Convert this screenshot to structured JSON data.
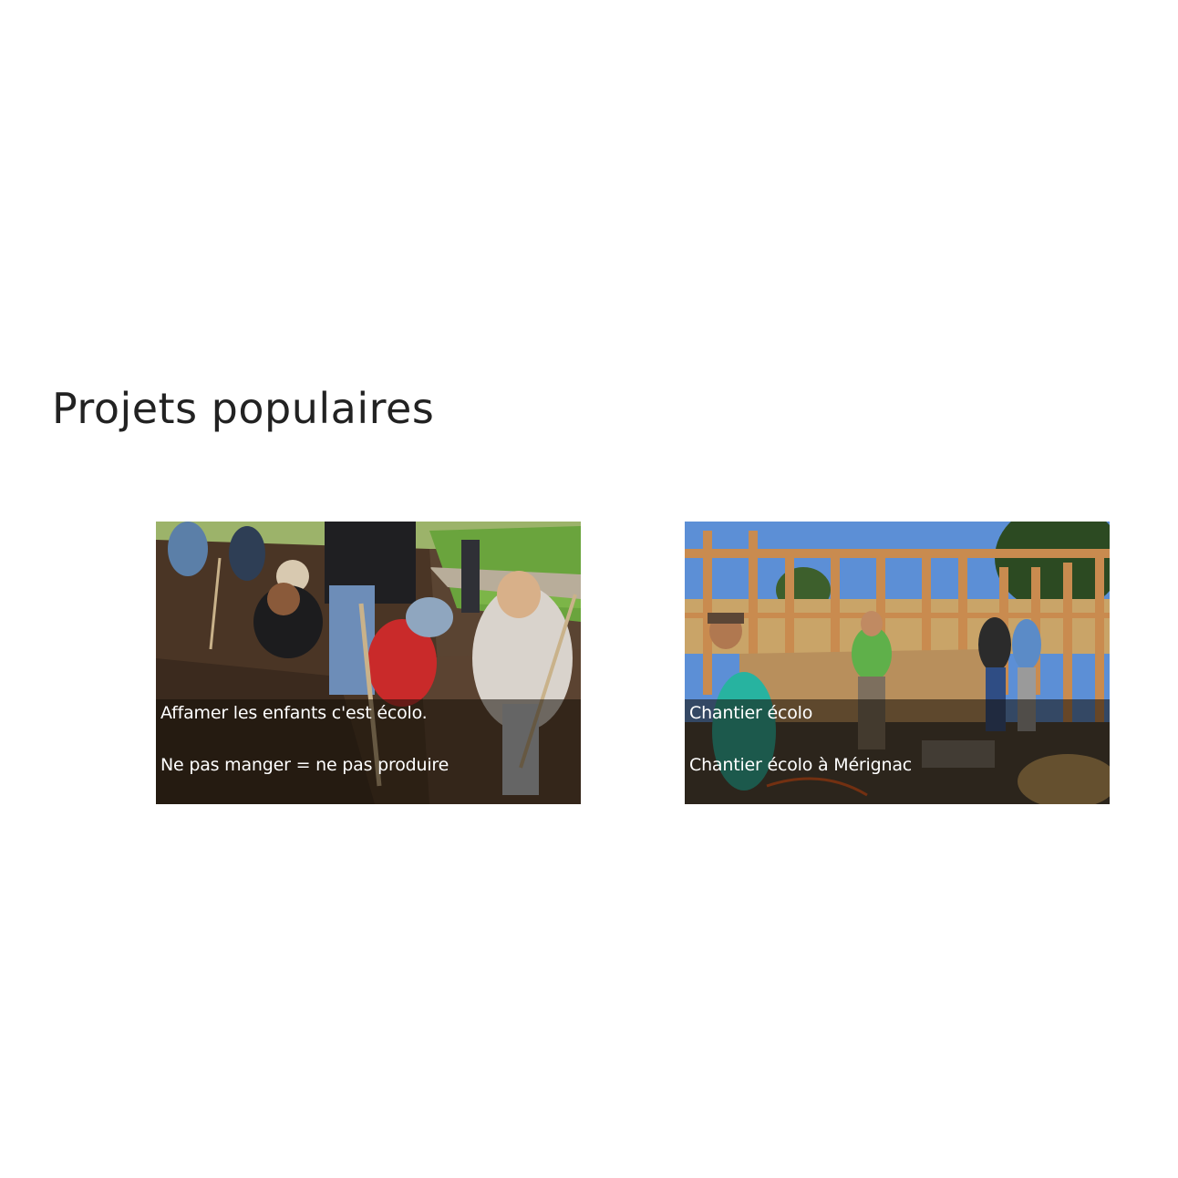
{
  "section": {
    "title": "Projets populaires"
  },
  "projects": [
    {
      "title": "Affamer les enfants c'est écolo.",
      "description": "Ne pas manger = ne pas produire",
      "image": "photo of children and adults digging soil in a garden"
    },
    {
      "title": "Chantier écolo",
      "description": "Chantier écolo à Mérignac",
      "image": "photo of people building a timber and straw-bale wall"
    }
  ],
  "colors": {
    "background": "#ffffff",
    "title_text": "#222222",
    "overlay": "rgba(20,14,8,0.55)",
    "caption_text": "#ffffff"
  }
}
